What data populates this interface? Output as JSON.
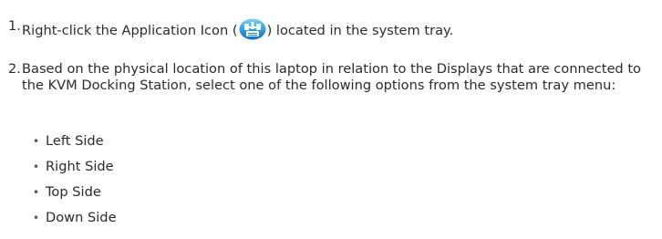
{
  "steps": [
    {
      "number": "1.",
      "text_before_icon": "Right-click the Application Icon (",
      "icon": "application-tray-icon",
      "text_after_icon": ") located in the system tray."
    },
    {
      "number": "2.",
      "text": "Based on the physical location of this laptop in relation to the Displays that are connected to the KVM Docking Station, select one of the following options from the system tray menu:"
    }
  ],
  "options": [
    "Left Side",
    "Right Side",
    "Top Side",
    "Down Side"
  ],
  "bullet_glyph": "•",
  "colors": {
    "text": "#2b2b2b",
    "icon_blue": "#1e8ed8",
    "icon_light": "#7fd0f5"
  }
}
